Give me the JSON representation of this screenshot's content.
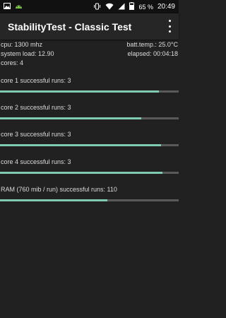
{
  "status_bar": {
    "battery_percent": "65 %",
    "time": "20:49",
    "icons": [
      "picture-icon",
      "android-icon",
      "vibrate-icon",
      "wifi-icon",
      "signal-icon",
      "battery-icon"
    ]
  },
  "app_bar": {
    "title": "StabilityTest - Classic Test",
    "menu_icon": "overflow-menu-icon"
  },
  "info": {
    "cpu": "cpu: 1300 mhz",
    "batt_temp": "batt.temp.: 25.0°C",
    "system_load": "system load: 12.90",
    "elapsed": "elapsed: 00:04:18",
    "cores": "cores: 4"
  },
  "tests": [
    {
      "label": "core 1 successful runs: 3",
      "progress": 0.89
    },
    {
      "label": "core 2 successful runs: 3",
      "progress": 0.79
    },
    {
      "label": "core 3 successful runs: 3",
      "progress": 0.9
    },
    {
      "label": "core 4 successful runs: 3",
      "progress": 0.91
    },
    {
      "label": "RAM (760 mib / run) successful runs: 110",
      "progress": 0.6
    }
  ],
  "colors": {
    "background": "#212121",
    "progress_fill": "#7fcbb4",
    "progress_track": "#5a5a5a"
  }
}
